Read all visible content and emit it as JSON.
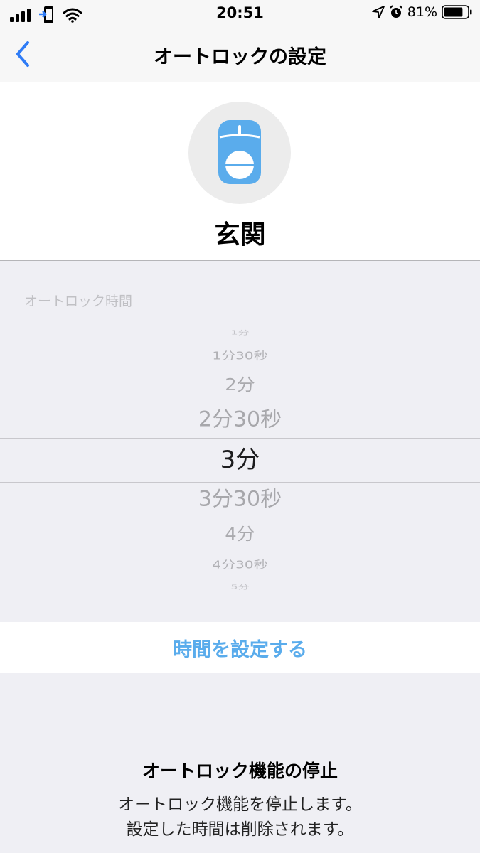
{
  "status_bar": {
    "time": "20:51",
    "battery_percent": "81%",
    "battery_level": 0.81
  },
  "nav": {
    "title": "オートロックの設定",
    "back_icon": "chevron-left-icon"
  },
  "device": {
    "name": "玄関",
    "icon": "smart-lock-icon",
    "accent_color": "#5aacec"
  },
  "picker": {
    "label": "オートロック時間",
    "items": [
      "1分",
      "1分30秒",
      "2分",
      "2分30秒",
      "3分",
      "3分30秒",
      "4分",
      "4分30秒",
      "5分"
    ],
    "selected_index": 4
  },
  "set_button": {
    "label": "時間を設定する"
  },
  "disable": {
    "title": "オートロック機能の停止",
    "description_line1": "オートロック機能を停止します。",
    "description_line2": "設定した時間は削除されます。"
  }
}
